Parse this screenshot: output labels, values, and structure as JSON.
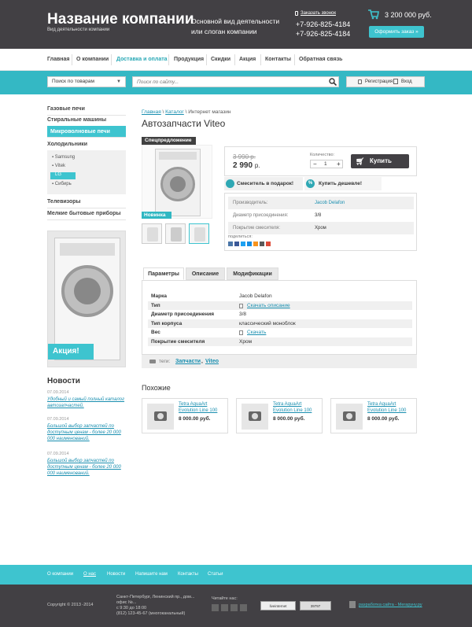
{
  "header": {
    "company": "Название компании",
    "tagline": "Вид деятельности компании",
    "slogan_1": "Основной вид деятельности",
    "slogan_2": "или слоган компании",
    "callback": "Заказать звонок",
    "phone_1": "+7-926-825-4184",
    "phone_2": "+7-926-825-4184",
    "cart_sum": "3 200 000 руб.",
    "order_button": "Оформить заказ »"
  },
  "nav": [
    "Главная",
    "О компании",
    "Доставка и оплата",
    "Продукция",
    "Скидки",
    "Акция",
    "Контакты",
    "Обратная связь"
  ],
  "search": {
    "category": "Поиск по товарам",
    "placeholder": "Поиск по сайту...",
    "register": "Регистрация",
    "login": "Вход"
  },
  "sidebar": {
    "categories": [
      "Газовые печи",
      "Стиральные машины",
      "Микроволновые печи",
      "Холодильники",
      "Телевизоры",
      "Мелкие бытовые приборы"
    ],
    "subcategories": [
      "Samsung",
      "Vitek",
      "LG",
      "Сибирь"
    ],
    "promo_label": "Акция!"
  },
  "news": {
    "title": "Новости",
    "items": [
      {
        "date": "07.09.2014",
        "text": "Удобный и самый полный каталог автозапчастей."
      },
      {
        "date": "07.09.2014",
        "text": "Большой выбор запчастей по доступным ценам - более 20 000 000 наименований."
      },
      {
        "date": "07.09.2014",
        "text": "Большой выбор запчастей по доступным ценам - более 20 000 000 наименований."
      }
    ]
  },
  "product": {
    "breadcrumb": [
      "Главная",
      "Каталог",
      "Интернет магазин"
    ],
    "title": "Автозапчасти Viteo",
    "badge_special": "Спецпредложение",
    "badge_new": "Новинка",
    "old_price": "3 990 р.",
    "price": "2 990",
    "price_unit": "р.",
    "qty_label": "Количество:",
    "qty": "1",
    "buy_button": "Купить",
    "gift": "Смеситель  в подарок!",
    "cheaper": "Купить дешевле!",
    "props": [
      {
        "k": "Производитель:",
        "v": "Jacob Delafon"
      },
      {
        "k": "Диаметр присоединения:",
        "v": "3/8"
      },
      {
        "k": "Покрытие смесителя:",
        "v": "Хром"
      }
    ],
    "share_label": "поделиться:"
  },
  "tabs": [
    "Параметры",
    "Описание",
    "Модификации"
  ],
  "specs": [
    {
      "k": "Марка",
      "v": "Jacob Delafon"
    },
    {
      "k": "Тип",
      "v": "Скачать описание"
    },
    {
      "k": "Диаметр присоединения",
      "v": "3/8"
    },
    {
      "k": "Тип корпуса",
      "v": "классический моноблок"
    },
    {
      "k": "Вес",
      "v": "Скачать"
    },
    {
      "k": "Покрытие смесителя",
      "v": "Хром"
    }
  ],
  "tags": {
    "label": "теги:",
    "items": [
      "Запчасти",
      "Viteo"
    ]
  },
  "similar": {
    "title": "Похожие",
    "items": [
      {
        "name": "Tetra AquaArt Evolution Line 100",
        "price": "8 000.00 руб."
      },
      {
        "name": "Tetra AquaArt Evolution Line 100",
        "price": "8 000.00 руб."
      },
      {
        "name": "Tetra AquaArt Evolution Line 100",
        "price": "8 000.00 руб."
      }
    ]
  },
  "footer": {
    "links": [
      "О компании",
      "О нас",
      "Новости",
      "Напишите нам",
      "Контакты",
      "Статьи"
    ],
    "copyright": "Copyright © 2013 -2014",
    "address_1": "Санкт-Петербург, Ленинский пр., дом...",
    "address_2": "офис №...",
    "hours": "с 9:30 до 18:00",
    "phone": "(812) 123-45-67 (многоканальный)",
    "read_us": "Читайте нас:",
    "counter_1": "liveinternet",
    "counter_2": "39797",
    "dev": "разработка сайта - Мегаруну.ру"
  },
  "colors": {
    "accent": "#3ec4cf",
    "dark": "#424044",
    "link": "#1a8fb0"
  }
}
